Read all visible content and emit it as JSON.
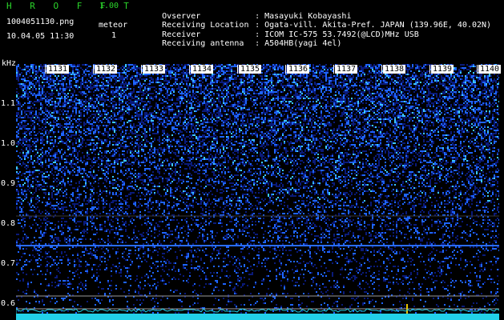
{
  "app": {
    "name": "H R O F F T",
    "version": "1.00"
  },
  "file": {
    "name": "1004051130.png",
    "datetime": "10.04.05 11:30"
  },
  "meteor": {
    "label": "meteor",
    "count": "1"
  },
  "info": [
    {
      "label": "Ovserver",
      "value": "Masayuki Kobayashi"
    },
    {
      "label": "Receiving Location",
      "value": "Ogata-vill. Akita-Pref. JAPAN (139.96E, 40.02N)"
    },
    {
      "label": "Receiver",
      "value": "ICOM IC-575 53.7492(@LCD)MHz USB"
    },
    {
      "label": "Receiving antenna",
      "value": "A504HB(yagi 4el)"
    }
  ],
  "spectrogram": {
    "y_unit": "kHz",
    "y_ticks": [
      "1.1",
      "1.0",
      "0.9",
      "0.8",
      "0.7",
      "0.6"
    ],
    "x_ticks": [
      "1131",
      "1132",
      "1133",
      "1134",
      "1135",
      "1136",
      "1137",
      "1138",
      "1139",
      "1140"
    ],
    "colors": {
      "background": "#000000",
      "noise_low": "#0a1a7a",
      "noise_high": "#1e64ff",
      "noise_peak": "#3cc8ff",
      "carrier": "#2a6cff",
      "baseline": "#22d0e8",
      "meteor_mark": "#e8c400",
      "guide_line": "#9a9a9a"
    }
  }
}
